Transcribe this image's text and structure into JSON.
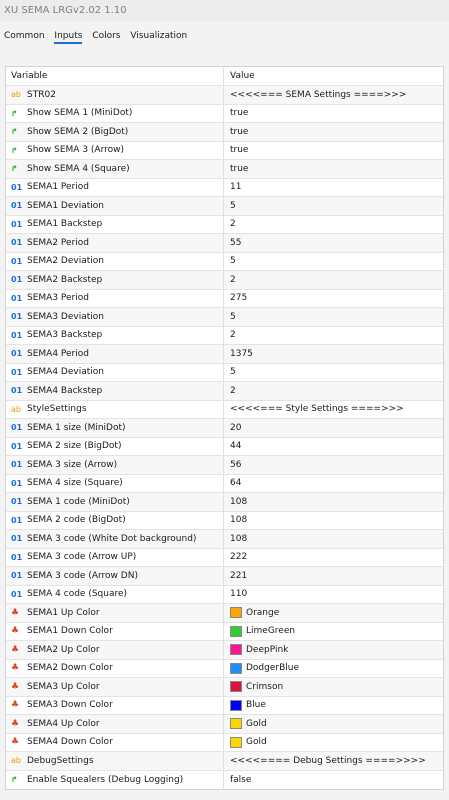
{
  "window": {
    "title": "XU SEMA LRGv2.02 1.10"
  },
  "tabs": [
    "Common",
    "Inputs",
    "Colors",
    "Visualization"
  ],
  "active_tab": "Inputs",
  "table": {
    "headers": {
      "variable": "Variable",
      "value": "Value"
    },
    "rows": [
      {
        "icon": "ab",
        "name": "STR02",
        "value": "<<<<=== SEMA Settings ====>>>"
      },
      {
        "icon": "bool",
        "name": "Show SEMA 1 (MiniDot)",
        "value": "true"
      },
      {
        "icon": "bool",
        "name": "Show SEMA 2 (BigDot)",
        "value": "true"
      },
      {
        "icon": "bool",
        "name": "Show SEMA 3 (Arrow)",
        "value": "true"
      },
      {
        "icon": "bool",
        "name": "Show SEMA 4 (Square)",
        "value": "true"
      },
      {
        "icon": "num",
        "name": "SEMA1 Period",
        "value": "11"
      },
      {
        "icon": "num",
        "name": "SEMA1 Deviation",
        "value": "5"
      },
      {
        "icon": "num",
        "name": "SEMA1 Backstep",
        "value": "2"
      },
      {
        "icon": "num",
        "name": "SEMA2 Period",
        "value": "55"
      },
      {
        "icon": "num",
        "name": "SEMA2 Deviation",
        "value": "5"
      },
      {
        "icon": "num",
        "name": "SEMA2 Backstep",
        "value": "2"
      },
      {
        "icon": "num",
        "name": "SEMA3 Period",
        "value": "275"
      },
      {
        "icon": "num",
        "name": "SEMA3 Deviation",
        "value": "5"
      },
      {
        "icon": "num",
        "name": "SEMA3 Backstep",
        "value": "2"
      },
      {
        "icon": "num",
        "name": "SEMA4 Period",
        "value": "1375"
      },
      {
        "icon": "num",
        "name": "SEMA4 Deviation",
        "value": "5"
      },
      {
        "icon": "num",
        "name": "SEMA4 Backstep",
        "value": "2"
      },
      {
        "icon": "ab",
        "name": "StyleSettings",
        "value": "<<<<=== Style Settings ====>>>"
      },
      {
        "icon": "num",
        "name": "SEMA 1 size (MiniDot)",
        "value": "20"
      },
      {
        "icon": "num",
        "name": "SEMA 2 size (BigDot)",
        "value": "44"
      },
      {
        "icon": "num",
        "name": "SEMA 3 size (Arrow)",
        "value": "56"
      },
      {
        "icon": "num",
        "name": "SEMA 4 size (Square)",
        "value": "64"
      },
      {
        "icon": "num",
        "name": "SEMA 1 code (MiniDot)",
        "value": "108"
      },
      {
        "icon": "num",
        "name": "SEMA 2 code (BigDot)",
        "value": "108"
      },
      {
        "icon": "num",
        "name": "SEMA 3 code (White Dot background)",
        "value": "108"
      },
      {
        "icon": "num",
        "name": "SEMA 3 code (Arrow UP)",
        "value": "222"
      },
      {
        "icon": "num",
        "name": "SEMA 3 code (Arrow DN)",
        "value": "221"
      },
      {
        "icon": "num",
        "name": "SEMA 4 code (Square)",
        "value": "110"
      },
      {
        "icon": "color",
        "name": "SEMA1 Up Color",
        "value": "Orange",
        "swatch": "#FFA500"
      },
      {
        "icon": "color",
        "name": "SEMA1 Down Color",
        "value": "LimeGreen",
        "swatch": "#32CD32"
      },
      {
        "icon": "color",
        "name": "SEMA2 Up Color",
        "value": "DeepPink",
        "swatch": "#FF1493"
      },
      {
        "icon": "color",
        "name": "SEMA2 Down Color",
        "value": "DodgerBlue",
        "swatch": "#1E90FF"
      },
      {
        "icon": "color",
        "name": "SEMA3 Up Color",
        "value": "Crimson",
        "swatch": "#DC143C"
      },
      {
        "icon": "color",
        "name": "SEMA3 Down Color",
        "value": "Blue",
        "swatch": "#0000FF"
      },
      {
        "icon": "color",
        "name": "SEMA4 Up Color",
        "value": "Gold",
        "swatch": "#FFD700"
      },
      {
        "icon": "color",
        "name": "SEMA4 Down Color",
        "value": "Gold",
        "swatch": "#FFD700"
      },
      {
        "icon": "ab",
        "name": "DebugSettings",
        "value": "<<<<==== Debug Settings ====>>>>"
      },
      {
        "icon": "bool",
        "name": "Enable Squealers (Debug Logging)",
        "value": "false"
      }
    ]
  },
  "icon_glyphs": {
    "ab": "ab",
    "num": "01",
    "color": "♣",
    "bool": "↱"
  }
}
